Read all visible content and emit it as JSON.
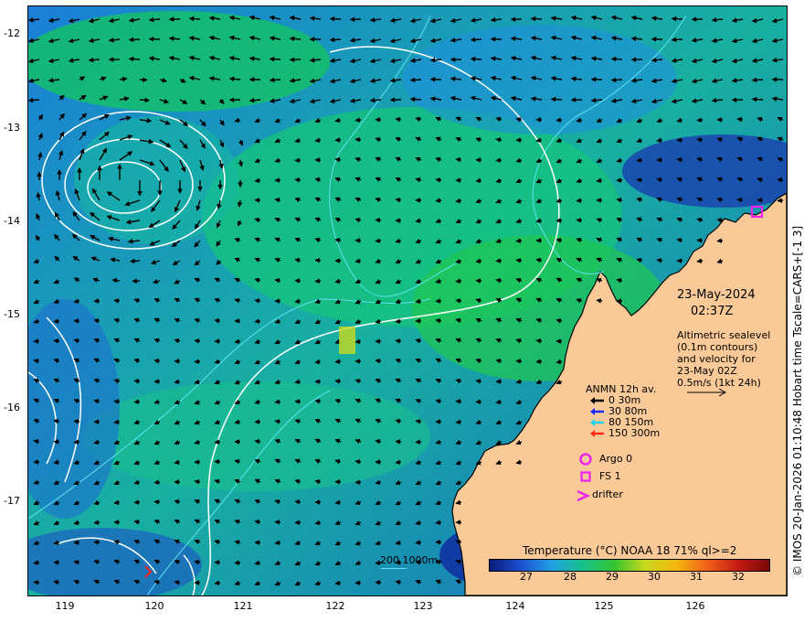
{
  "map": {
    "date": "23-May-2024",
    "time": "02:37Z",
    "y_ticks": [
      "-12",
      "-13",
      "-14",
      "-15",
      "-16",
      "-17"
    ],
    "x_ticks": [
      "119",
      "120",
      "121",
      "122",
      "123",
      "124",
      "125",
      "126"
    ],
    "description_lines": [
      "Altimetric sealevel",
      "(0.1m contours)",
      "and velocity for",
      "23-May 02Z",
      "0.5m/s (1kt 24h)"
    ],
    "legend": {
      "title": "ANMN 12h av.",
      "items": [
        {
          "label": "0 30m",
          "color": "#000000"
        },
        {
          "label": "30 80m",
          "color": "#1a2cff"
        },
        {
          "label": "80 150m",
          "color": "#22d4f0"
        },
        {
          "label": "150 300m",
          "color": "#ff2a1a"
        }
      ]
    },
    "markers": [
      {
        "label": "Argo 0",
        "shape": "circle",
        "color": "#ee22ee"
      },
      {
        "label": "FS 1",
        "shape": "square",
        "color": "#ee22ee"
      },
      {
        "label": "drifter",
        "shape": "chevron",
        "color": "#ee22ee"
      }
    ],
    "isobath_label": "200  1000m",
    "colorbar": {
      "title": "Temperature (°C) NOAA 18 71% ql>=2",
      "ticks": [
        "27",
        "28",
        "29",
        "30",
        "31",
        "32"
      ],
      "colors": [
        "#0a1a78",
        "#1b4fd2",
        "#22a0e6",
        "#16c08a",
        "#32c432",
        "#c9d81e",
        "#f4b80e",
        "#f06018",
        "#c41a12",
        "#7a0a08"
      ]
    },
    "side_caption": "© IMOS 20-Jan-2026 01:10:48 Hobart time Tscale=CARS+[-1 3]",
    "land_color": "#f9c998"
  }
}
